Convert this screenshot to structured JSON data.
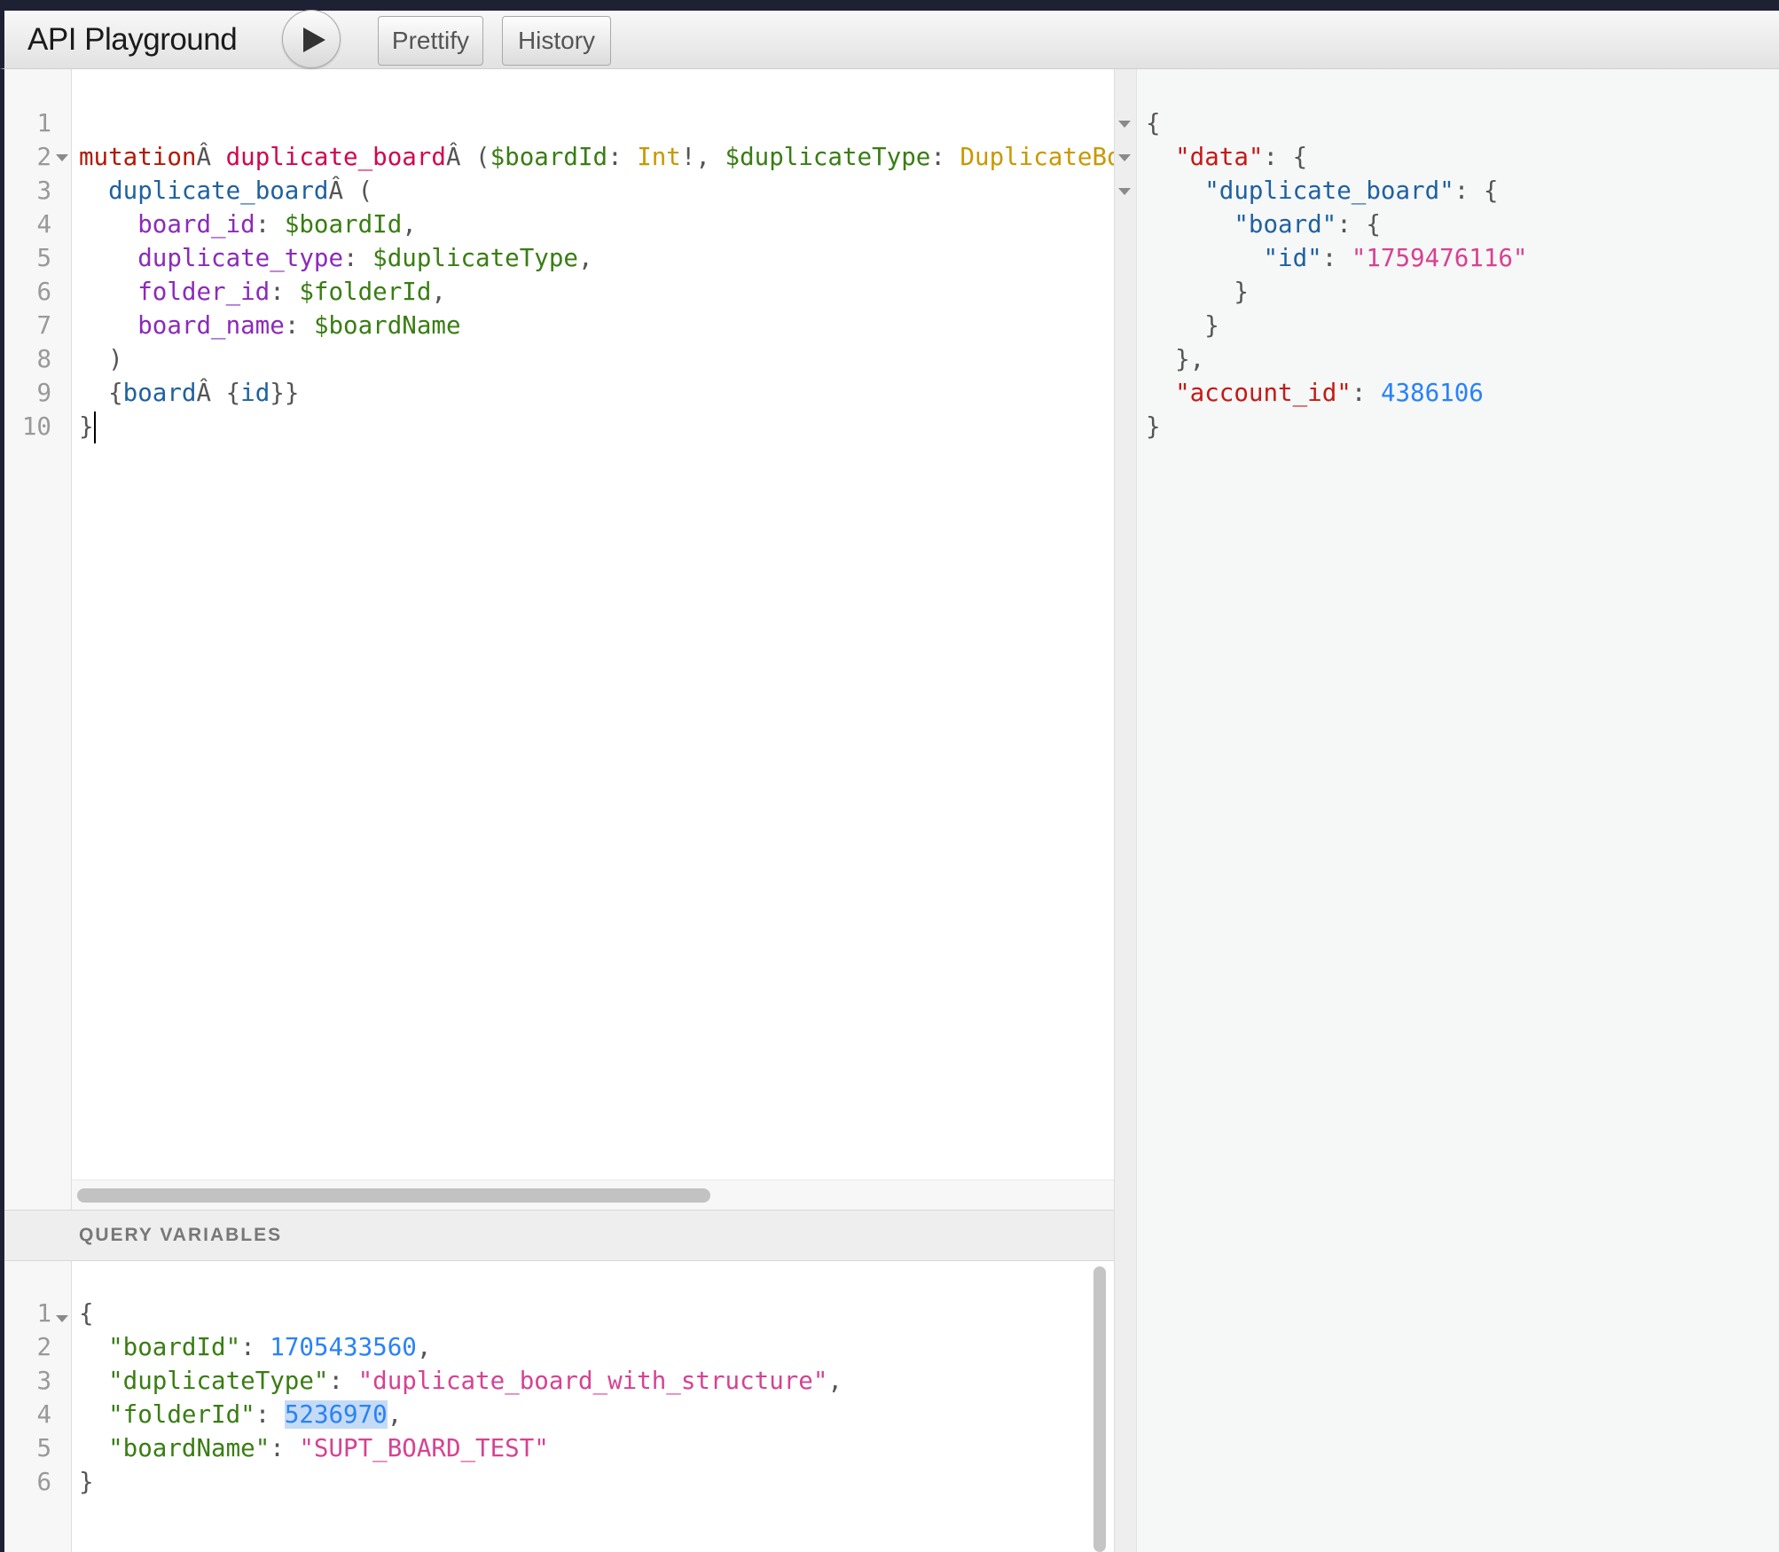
{
  "header": {
    "title": "API Playground",
    "prettify_label": "Prettify",
    "history_label": "History",
    "run_icon": "play-icon"
  },
  "query_editor": {
    "line_numbers": [
      "1",
      "2",
      "3",
      "4",
      "5",
      "6",
      "7",
      "8",
      "9",
      "10"
    ],
    "lines": [
      [],
      [
        [
          "k-kw",
          "mutation"
        ],
        [
          "",
          "Â "
        ],
        [
          "k-def",
          "duplicate_board"
        ],
        [
          "",
          "Â ("
        ],
        [
          "k-var",
          "$boardId"
        ],
        [
          "",
          ": "
        ],
        [
          "k-type",
          "Int"
        ],
        [
          "",
          "!, "
        ],
        [
          "k-var",
          "$duplicateType"
        ],
        [
          "",
          ": "
        ],
        [
          "k-type",
          "DuplicateBoardTyp"
        ]
      ],
      [
        [
          "",
          "  "
        ],
        [
          "k-field",
          "duplicate_board"
        ],
        [
          "",
          ""
        ],
        [
          "",
          "Â ("
        ]
      ],
      [
        [
          "",
          "    "
        ],
        [
          "k-arg",
          "board_id"
        ],
        [
          "",
          ": "
        ],
        [
          "k-var",
          "$boardId"
        ],
        [
          "",
          ","
        ]
      ],
      [
        [
          "",
          "    "
        ],
        [
          "k-arg",
          "duplicate_type"
        ],
        [
          "",
          ": "
        ],
        [
          "k-var",
          "$duplicateType"
        ],
        [
          "",
          ","
        ]
      ],
      [
        [
          "",
          "    "
        ],
        [
          "k-arg",
          "folder_id"
        ],
        [
          "",
          ": "
        ],
        [
          "k-var",
          "$folderId"
        ],
        [
          "",
          ","
        ]
      ],
      [
        [
          "",
          "    "
        ],
        [
          "k-arg",
          "board_name"
        ],
        [
          "",
          ": "
        ],
        [
          "k-var",
          "$boardName"
        ]
      ],
      [
        [
          "",
          "  )"
        ]
      ],
      [
        [
          "",
          "  {"
        ],
        [
          "k-field",
          "board"
        ],
        [
          "",
          "Â {"
        ],
        [
          "k-field",
          "id"
        ],
        [
          "",
          "}}"
        ]
      ],
      [
        [
          "",
          "}"
        ]
      ]
    ]
  },
  "variables_panel": {
    "title": "QUERY VARIABLES",
    "line_numbers": [
      "1",
      "2",
      "3",
      "4",
      "5",
      "6"
    ],
    "lines": [
      [
        [
          "",
          "{"
        ]
      ],
      [
        [
          "",
          "  "
        ],
        [
          "k-vk",
          "\"boardId\""
        ],
        [
          "",
          ": "
        ],
        [
          "k-num",
          "1705433560"
        ],
        [
          "",
          ","
        ]
      ],
      [
        [
          "",
          "  "
        ],
        [
          "k-vk",
          "\"duplicateType\""
        ],
        [
          "",
          ": "
        ],
        [
          "k-str",
          "\"duplicate_board_with_structure\""
        ],
        [
          "",
          ","
        ]
      ],
      [
        [
          "",
          "  "
        ],
        [
          "k-vk",
          "\"folderId\""
        ],
        [
          "",
          ": "
        ],
        [
          "k-num hl",
          "5236970"
        ],
        [
          "",
          ","
        ]
      ],
      [
        [
          "",
          "  "
        ],
        [
          "k-vk",
          "\"boardName\""
        ],
        [
          "",
          ": "
        ],
        [
          "k-str",
          "\"SUPT_BOARD_TEST\""
        ]
      ],
      [
        [
          "",
          "}"
        ]
      ]
    ]
  },
  "result_panel": {
    "lines": [
      [
        [
          "",
          "{"
        ]
      ],
      [
        [
          "",
          "  "
        ],
        [
          "k-jk",
          "\"data\""
        ],
        [
          "",
          ": {"
        ]
      ],
      [
        [
          "",
          "    "
        ],
        [
          "k-jk2",
          "\"duplicate_board\""
        ],
        [
          "",
          ": {"
        ]
      ],
      [
        [
          "",
          "      "
        ],
        [
          "k-jk2",
          "\"board\""
        ],
        [
          "",
          ": {"
        ]
      ],
      [
        [
          "",
          "        "
        ],
        [
          "k-jk2",
          "\"id\""
        ],
        [
          "",
          ": "
        ],
        [
          "k-str",
          "\"1759476116\""
        ]
      ],
      [
        [
          "",
          "      }"
        ]
      ],
      [
        [
          "",
          "    }"
        ]
      ],
      [
        [
          "",
          "  },"
        ]
      ],
      [
        [
          "",
          "  "
        ],
        [
          "k-jk",
          "\"account_id\""
        ],
        [
          "",
          ": "
        ],
        [
          "k-num",
          "4386106"
        ]
      ],
      [
        [
          "",
          "}"
        ]
      ]
    ]
  },
  "colors": {
    "keyword": "#b11a04",
    "definition": "#d2054e",
    "variable": "#397d13",
    "type": "#ca9800",
    "field": "#1f61a0",
    "argument": "#8b2bb9",
    "string": "#d64292",
    "number": "#2882f9"
  }
}
